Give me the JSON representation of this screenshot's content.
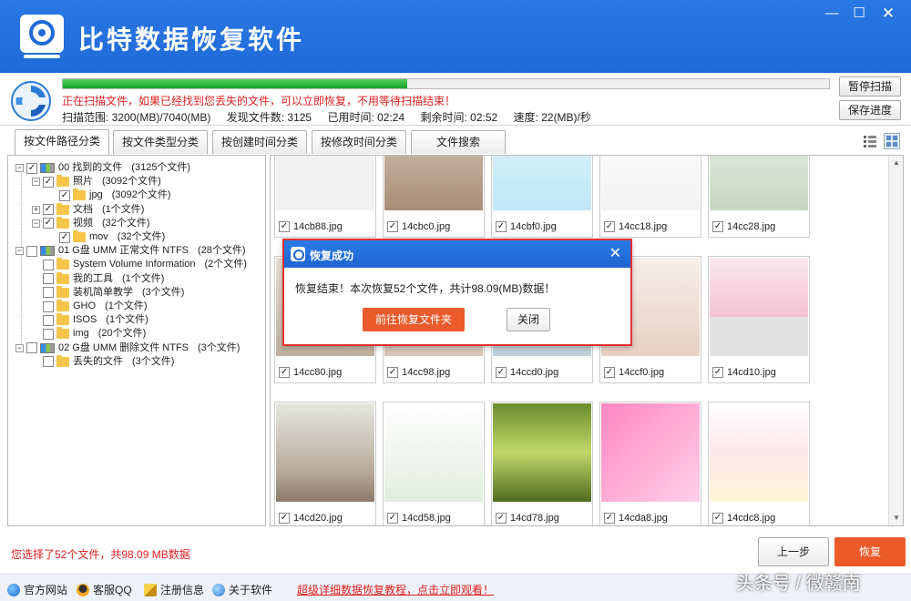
{
  "app": {
    "title": "比特数据恢复软件",
    "window_controls": {
      "minimize": "—",
      "maximize": "☐",
      "close": "✕"
    }
  },
  "scan": {
    "progress": 0.45,
    "message": "正在扫描文件，如果已经找到您丢失的文件，可以立即恢复，不用等待扫描结束！",
    "stats": {
      "range": "扫描范围: 3200(MB)/7040(MB)",
      "found": "发现文件数: 3125",
      "elapsed": "已用时间: 02:24",
      "remaining": "剩余时间: 02:52",
      "speed": "速度: 22(MB)/秒"
    },
    "pause_label": "暂停扫描",
    "save_label": "保存进度"
  },
  "tabs": [
    {
      "label": "按文件路径分类",
      "active": true
    },
    {
      "label": "按文件类型分类",
      "active": false
    },
    {
      "label": "按创建时间分类",
      "active": false
    },
    {
      "label": "按修改时间分类",
      "active": false
    },
    {
      "label": "文件搜索",
      "active": false
    }
  ],
  "tree": [
    {
      "label": "00 找到的文件",
      "count": "(3125个文件)",
      "checked": true,
      "exp": "−",
      "icon": "drive"
    },
    {
      "label": "照片",
      "count": "(3092个文件)",
      "checked": true,
      "exp": "−",
      "icon": "folder"
    },
    {
      "label": "jpg",
      "count": "(3092个文件)",
      "checked": true,
      "exp": "",
      "icon": "folder"
    },
    {
      "label": "文档",
      "count": "(1个文件)",
      "checked": true,
      "exp": "+",
      "icon": "folder"
    },
    {
      "label": "视频",
      "count": "(32个文件)",
      "checked": true,
      "exp": "−",
      "icon": "folder"
    },
    {
      "label": "mov",
      "count": "(32个文件)",
      "checked": true,
      "exp": "",
      "icon": "folder"
    },
    {
      "label": "01 G盘 UMM 正常文件 NTFS",
      "count": "(28个文件)",
      "checked": false,
      "exp": "−",
      "icon": "drive"
    },
    {
      "label": "System Volume Information",
      "count": "(2个文件)",
      "checked": false,
      "exp": "",
      "icon": "folder"
    },
    {
      "label": "我的工具",
      "count": "(1个文件)",
      "checked": false,
      "exp": "",
      "icon": "folder"
    },
    {
      "label": "装机简单教学",
      "count": "(3个文件)",
      "checked": false,
      "exp": "",
      "icon": "folder"
    },
    {
      "label": "GHO",
      "count": "(1个文件)",
      "checked": false,
      "exp": "",
      "icon": "folder"
    },
    {
      "label": "ISOS",
      "count": "(1个文件)",
      "checked": false,
      "exp": "",
      "icon": "folder"
    },
    {
      "label": "img",
      "count": "(20个文件)",
      "checked": false,
      "exp": "",
      "icon": "folder"
    },
    {
      "label": "02 G盘 UMM 删除文件 NTFS",
      "count": "(3个文件)",
      "checked": false,
      "exp": "−",
      "icon": "drive"
    },
    {
      "label": "丢失的文件",
      "count": "(3个文件)",
      "checked": false,
      "exp": "",
      "icon": "folder"
    }
  ],
  "thumbnails": [
    {
      "name": "14cb88.jpg"
    },
    {
      "name": "14cbc0.jpg"
    },
    {
      "name": "14cbf0.jpg"
    },
    {
      "name": "14cc18.jpg"
    },
    {
      "name": "14cc28.jpg"
    },
    {
      "name": "14cc80.jpg"
    },
    {
      "name": "14cc98.jpg"
    },
    {
      "name": "14ccd0.jpg"
    },
    {
      "name": "14ccf0.jpg"
    },
    {
      "name": "14cd10.jpg"
    },
    {
      "name": "14cd20.jpg"
    },
    {
      "name": "14cd58.jpg"
    },
    {
      "name": "14cd78.jpg"
    },
    {
      "name": "14cda8.jpg"
    },
    {
      "name": "14cdc8.jpg"
    }
  ],
  "dialog": {
    "title": "恢复成功",
    "close_glyph": "✕",
    "message": "恢复结束！本次恢复52个文件，共计98.09(MB)数据！",
    "primary_label": "前往恢复文件夹",
    "close_label": "关闭"
  },
  "bottom": {
    "selection_info": "您选择了52个文件，共98.09 MB数据",
    "prev_label": "上一步",
    "recover_label": "恢复"
  },
  "footer": {
    "website": "官方网站",
    "qq": "客服QQ",
    "register": "注册信息",
    "about": "关于软件",
    "tutorial_link": "超级详细数据恢复教程，点击立即观看！"
  },
  "watermark": "头条号 / 微赣南",
  "colors": {
    "title_bar": "#1f6ad8",
    "accent_orange": "#ea5a2b",
    "alert_red": "#e02020",
    "progress_green": "#1aa12a"
  }
}
